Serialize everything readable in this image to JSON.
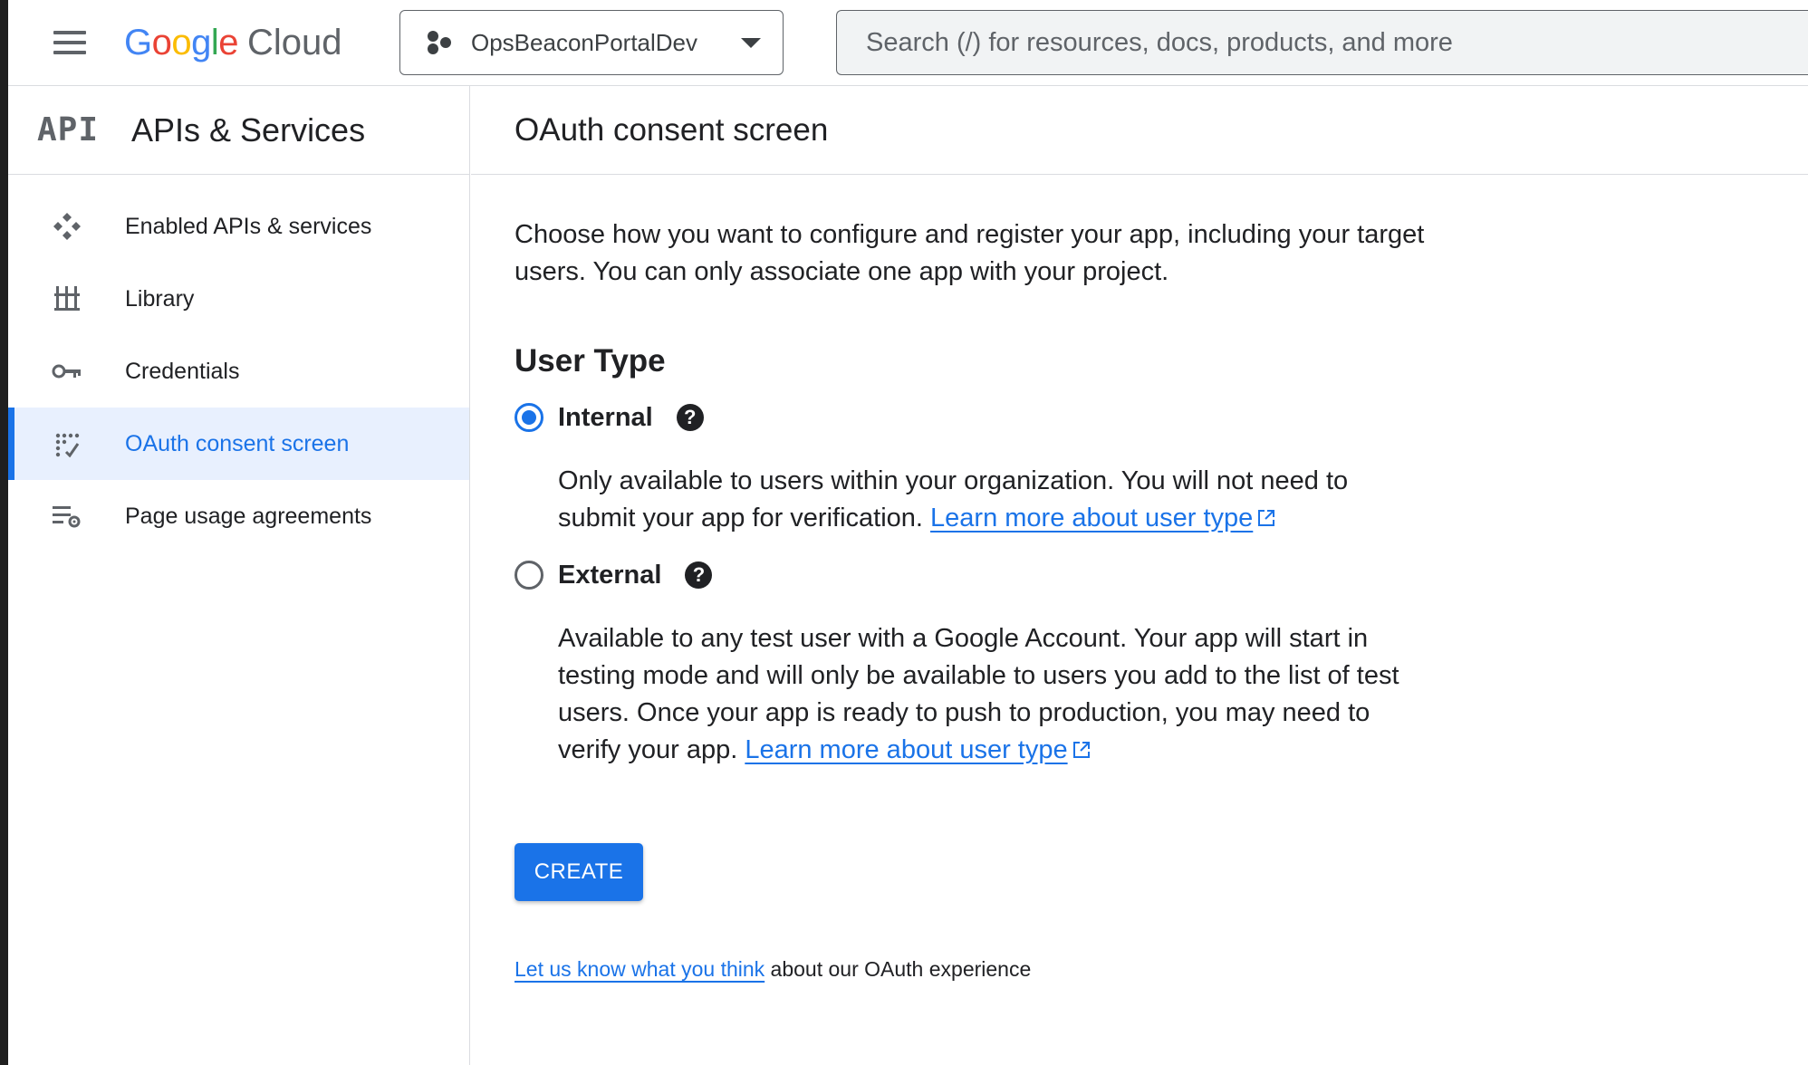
{
  "header": {
    "brand_google": [
      "G",
      "o",
      "o",
      "g",
      "l",
      "e"
    ],
    "brand_cloud": "Cloud",
    "project_name": "OpsBeaconPortalDev",
    "search_placeholder": "Search (/) for resources, docs, products, and more"
  },
  "sidebar": {
    "logo_text": "API",
    "title": "APIs & Services",
    "items": [
      {
        "label": "Enabled APIs & services",
        "icon": "enabled-apis-icon"
      },
      {
        "label": "Library",
        "icon": "library-icon"
      },
      {
        "label": "Credentials",
        "icon": "key-icon"
      },
      {
        "label": "OAuth consent screen",
        "icon": "oauth-consent-icon",
        "active": true
      },
      {
        "label": "Page usage agreements",
        "icon": "page-usage-icon"
      }
    ]
  },
  "main": {
    "title": "OAuth consent screen",
    "intro": "Choose how you want to configure and register your app, including your target users. You can only associate one app with your project.",
    "user_type_title": "User Type",
    "internal": {
      "label": "Internal",
      "checked": true,
      "description": "Only available to users within your organization. You will not need to submit your app for verification.",
      "link": "Learn more about user type"
    },
    "external": {
      "label": "External",
      "checked": false,
      "description": "Available to any test user with a Google Account. Your app will start in testing mode and will only be available to users you add to the list of test users. Once your app is ready to push to production, you may need to verify your app.",
      "link": "Learn more about user type"
    },
    "create_label": "CREATE",
    "feedback_link": "Let us know what you think",
    "feedback_text": " about our OAuth experience"
  },
  "colors": {
    "accent": "#1a73e8",
    "active_bg": "#e8f0fe",
    "divider": "#dadce0"
  }
}
